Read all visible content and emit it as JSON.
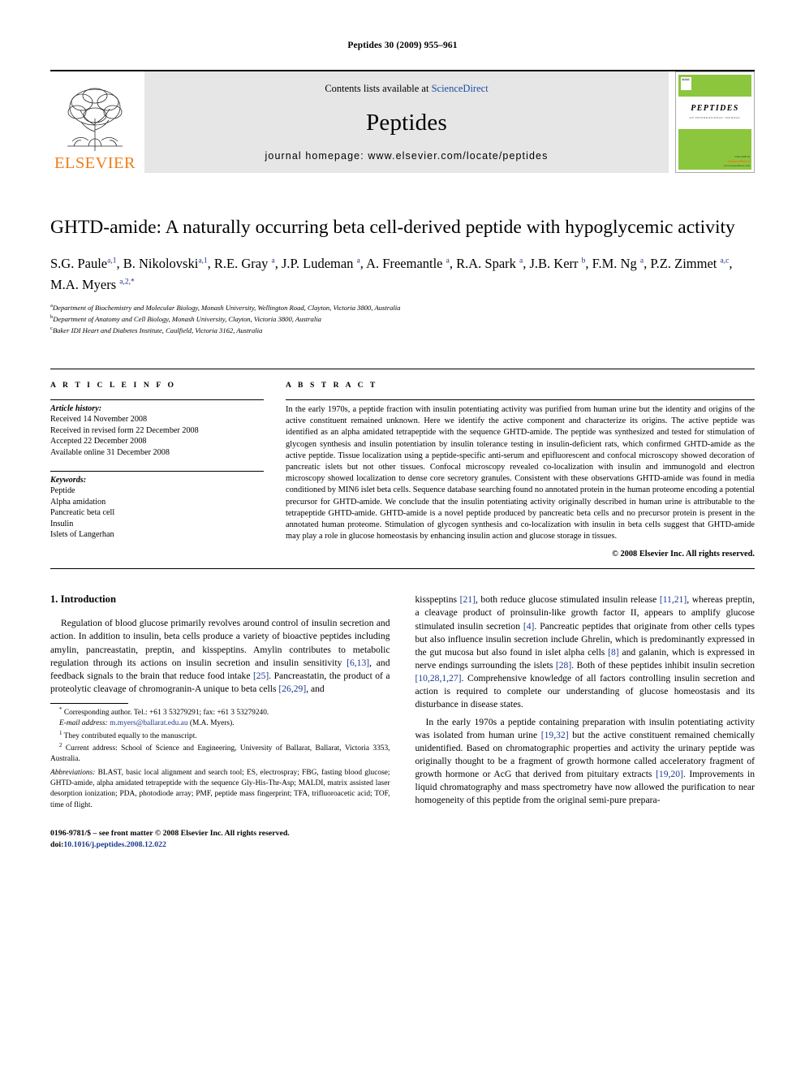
{
  "running_head": "Peptides 30 (2009) 955–961",
  "masthead": {
    "publisher_word": "ELSEVIER",
    "contents_prefix": "Contents lists available at ",
    "contents_link": "ScienceDirect",
    "journal_name": "Peptides",
    "homepage_line": "journal homepage: www.elsevier.com/locate/peptides",
    "cover": {
      "title": "PEPTIDES",
      "subtitle": "AN INTERNATIONAL JOURNAL",
      "footer_volume": "VOLUME 30",
      "footer_brand": "ScienceDirect",
      "footer_url": "www.sciencedirect.com"
    }
  },
  "article": {
    "title": "GHTD-amide: A naturally occurring beta cell-derived peptide with hypoglycemic activity",
    "authors_html": "S.G. Paule<sup class=\"aff\">a,1</sup>, B. Nikolovski<sup class=\"aff\">a,1</sup>, R.E. Gray <sup class=\"aff\">a</sup>, J.P. Ludeman <sup class=\"aff\">a</sup>, A. Freemantle <sup class=\"aff\">a</sup>, R.A. Spark <sup class=\"aff\">a</sup>, J.B. Kerr <sup class=\"aff\">b</sup>, F.M. Ng <sup class=\"aff\">a</sup>, P.Z. Zimmet <sup class=\"aff\">a,c</sup>, M.A. Myers <sup class=\"aff\">a,2,*</sup>",
    "affiliations": [
      {
        "marker": "a",
        "text": "Department of Biochemistry and Molecular Biology, Monash University, Wellington Road, Clayton, Victoria 3800, Australia"
      },
      {
        "marker": "b",
        "text": "Department of Anatomy and Cell Biology, Monash University, Clayton, Victoria 3800, Australia"
      },
      {
        "marker": "c",
        "text": "Baker IDI Heart and Diabetes Institute, Caulfield, Victoria 3162, Australia"
      }
    ]
  },
  "article_info": {
    "heading": "A R T I C L E  I N F O",
    "history_label": "Article history:",
    "history": [
      "Received 14 November 2008",
      "Received in revised form 22 December 2008",
      "Accepted 22 December 2008",
      "Available online 31 December 2008"
    ],
    "keywords_label": "Keywords:",
    "keywords": [
      "Peptide",
      "Alpha amidation",
      "Pancreatic beta cell",
      "Insulin",
      "Islets of Langerhan"
    ]
  },
  "abstract": {
    "heading": "A B S T R A C T",
    "text": "In the early 1970s, a peptide fraction with insulin potentiating activity was purified from human urine but the identity and origins of the active constituent remained unknown. Here we identify the active component and characterize its origins. The active peptide was identified as an alpha amidated tetrapeptide with the sequence GHTD-amide. The peptide was synthesized and tested for stimulation of glycogen synthesis and insulin potentiation by insulin tolerance testing in insulin-deficient rats, which confirmed GHTD-amide as the active peptide. Tissue localization using a peptide-specific anti-serum and epifluorescent and confocal microscopy showed decoration of pancreatic islets but not other tissues. Confocal microscopy revealed co-localization with insulin and immunogold and electron microscopy showed localization to dense core secretory granules. Consistent with these observations GHTD-amide was found in media conditioned by MIN6 islet beta cells. Sequence database searching found no annotated protein in the human proteome encoding a potential precursor for GHTD-amide. We conclude that the insulin potentiating activity originally described in human urine is attributable to the tetrapeptide GHTD-amide. GHTD-amide is a novel peptide produced by pancreatic beta cells and no precursor protein is present in the annotated human proteome. Stimulation of glycogen synthesis and co-localization with insulin in beta cells suggest that GHTD-amide may play a role in glucose homeostasis by enhancing insulin action and glucose storage in tissues.",
    "copyright": "© 2008 Elsevier Inc. All rights reserved."
  },
  "introduction": {
    "section_title": "1. Introduction",
    "left_paragraph_html": "Regulation of blood glucose primarily revolves around control of insulin secretion and action. In addition to insulin, beta cells produce a variety of bioactive peptides including amylin, pancreastatin, preptin, and kisspeptins. Amylin contributes to metabolic regulation through its actions on insulin secretion and insulin sensitivity <span class=\"ref\">[6,13]</span>, and feedback signals to the brain that reduce food intake <span class=\"ref\">[25]</span>. Pancreastatin, the product of a proteolytic cleavage of chromogranin-A unique to beta cells <span class=\"ref\">[26,29]</span>, and",
    "right_paragraph_1_html": "kisspeptins <span class=\"ref\">[21]</span>, both reduce glucose stimulated insulin release <span class=\"ref\">[11,21]</span>, whereas preptin, a cleavage product of proinsulin-like growth factor II, appears to amplify glucose stimulated insulin secretion <span class=\"ref\">[4]</span>. Pancreatic peptides that originate from other cells types but also influence insulin secretion include Ghrelin, which is predominantly expressed in the gut mucosa but also found in islet alpha cells <span class=\"ref\">[8]</span> and galanin, which is expressed in nerve endings surrounding the islets <span class=\"ref\">[28]</span>. Both of these peptides inhibit insulin secretion <span class=\"ref\">[10,28,1,27]</span>. Comprehensive knowledge of all factors controlling insulin secretion and action is required to complete our understanding of glucose homeostasis and its disturbance in disease states.",
    "right_paragraph_2_html": "In the early 1970s a peptide containing preparation with insulin potentiating activity was isolated from human urine <span class=\"ref\">[19,32]</span> but the active constituent remained chemically unidentified. Based on chromatographic properties and activity the urinary peptide was originally thought to be a fragment of growth hormone called acceleratory fragment of growth hormone or AcG that derived from pituitary extracts <span class=\"ref\">[19,20]</span>. Improvements in liquid chromatography and mass spectrometry have now allowed the purification to near homogeneity of this peptide from the original semi-pure prepara-"
  },
  "footnotes": {
    "corresponding_html": "<sup>*</sup> Corresponding author. Tel.: +61 3 53279291; fax: +61 3 53279240.",
    "email_html": "<span class=\"ital\">E-mail address:</span> <span class=\"link\">m.myers@ballarat.edu.au</span> (M.A. Myers).",
    "note1_html": "<sup>1</sup> They contributed equally to the manuscript.",
    "note2_html": "<sup>2</sup> Current address: School of Science and Engineering, University of Ballarat, Ballarat, Victoria 3353, Australia.",
    "abbreviations_html": "<span class=\"ital\">Abbreviations:</span> BLAST, basic local alignment and search tool; ES, electrospray; FBG, fasting blood glucose; GHTD-amide, alpha amidated tetrapeptide with the sequence Gly-His-Thr-Asp; MALDI, matrix assisted laser desorption ionization; PDA, photodiode array; PMF, peptide mass fingerprint; TFA, trifluoroacetic acid; TOF, time of flight."
  },
  "imprint": {
    "line1": "0196-9781/$ – see front matter © 2008 Elsevier Inc. All rights reserved.",
    "doi_prefix": "doi:",
    "doi_value": "10.1016/j.peptides.2008.12.022"
  },
  "colors": {
    "elsevier_orange": "#F07D1A",
    "link_blue": "#1c4fa1",
    "reference_blue": "#1a3a8f",
    "cover_green": "#8CC63E",
    "panel_gray": "#e6e6e6"
  }
}
